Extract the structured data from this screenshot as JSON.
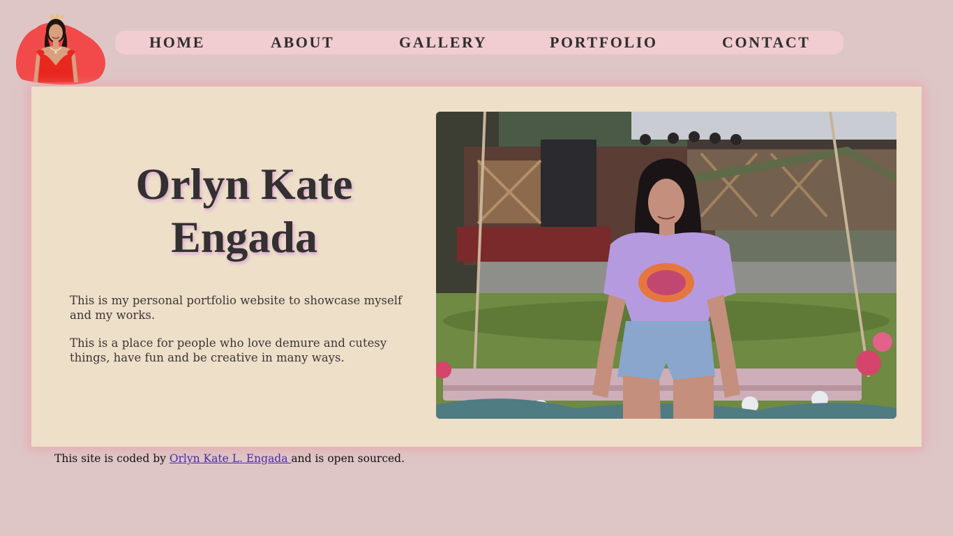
{
  "nav": {
    "home": "HOME",
    "about": "ABOUT",
    "gallery": "GALLERY",
    "portfolio": "PORTFOLIO",
    "contact": "CONTACT"
  },
  "hero": {
    "title": "Orlyn Kate Engada",
    "paragraph_1": "This is my personal portfolio website to showcase myself and my works.",
    "paragraph_2": "This is a place for people who love demure and cutesy things, have fun and be creative in many ways."
  },
  "footer": {
    "prefix": "This site is coded by ",
    "link_text": "Orlyn Kate L. Engada ",
    "suffix": "and is open sourced."
  },
  "colors": {
    "page_background": "#dec6c6",
    "nav_background": "#f1ccd1",
    "card_background": "#eedfc9",
    "logo_blob": "#f24a4a",
    "link": "#4b2aa8"
  },
  "icons": {
    "logo": "profile-avatar",
    "photo": "portrait-photo"
  }
}
